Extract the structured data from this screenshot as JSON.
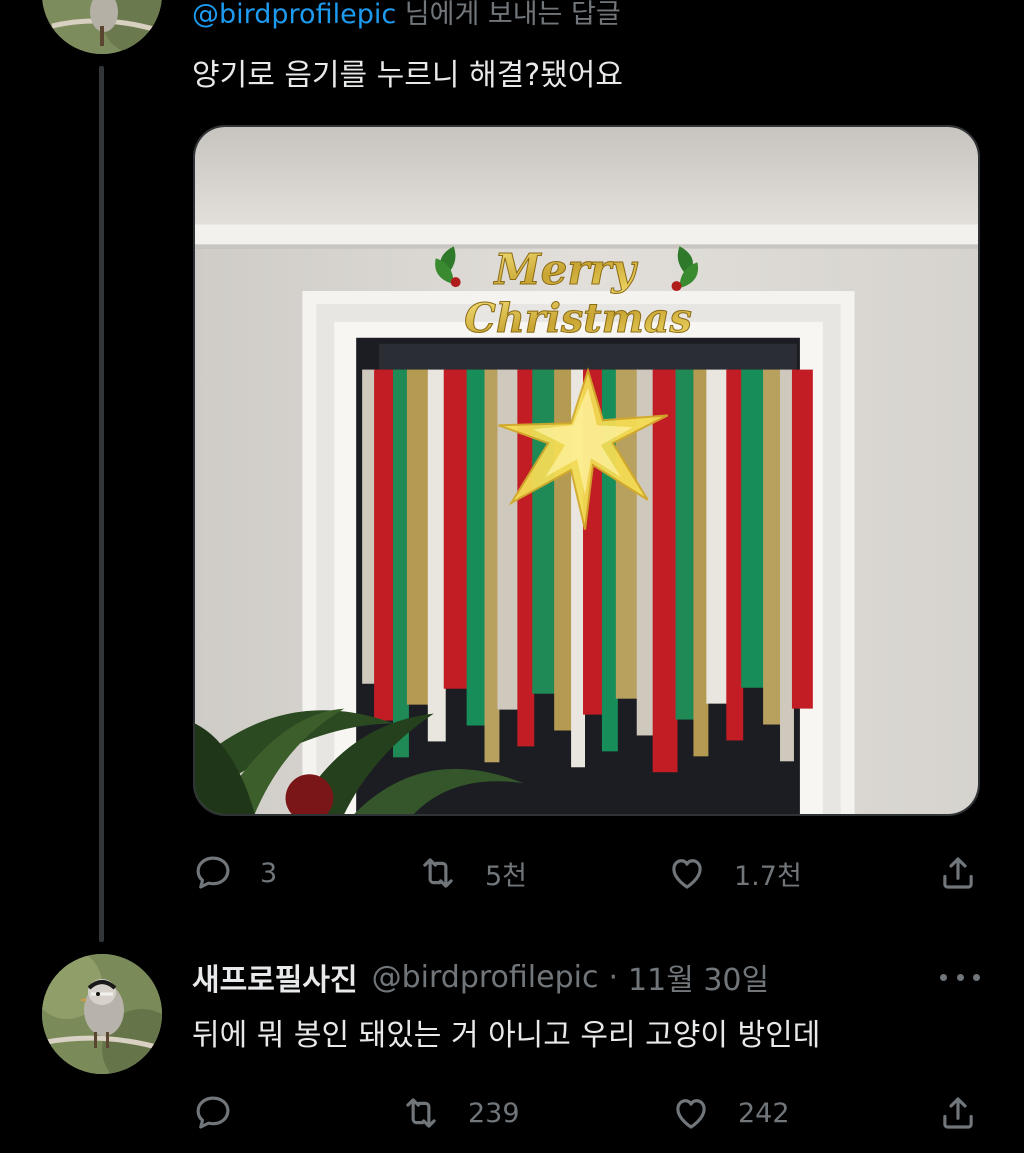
{
  "tweet1": {
    "reply_handle": "@birdprofilepic",
    "reply_suffix": " 님에게 보내는 답글",
    "text": "양기로 음기를 누르니 해결?됐어요",
    "image_sign_line1": "Merry",
    "image_sign_line2": "Christmas",
    "actions": {
      "replies": "3",
      "retweets": "5천",
      "likes": "1.7천"
    }
  },
  "tweet2": {
    "display_name": "새프로필사진",
    "handle": "@birdprofilepic",
    "separator": "·",
    "date": "11월 30일",
    "text": "뒤에 뭐 봉인 돼있는 거 아니고 우리 고양이 방인데",
    "actions": {
      "replies": "",
      "retweets": "239",
      "likes": "242"
    }
  },
  "icons": {
    "reply": "reply-icon",
    "retweet": "retweet-icon",
    "like": "heart-icon",
    "share": "share-icon",
    "more": "more-icon"
  },
  "colors": {
    "background": "#000000",
    "text": "#e7e9ea",
    "secondary": "#71767b",
    "link": "#1d9bf0"
  }
}
